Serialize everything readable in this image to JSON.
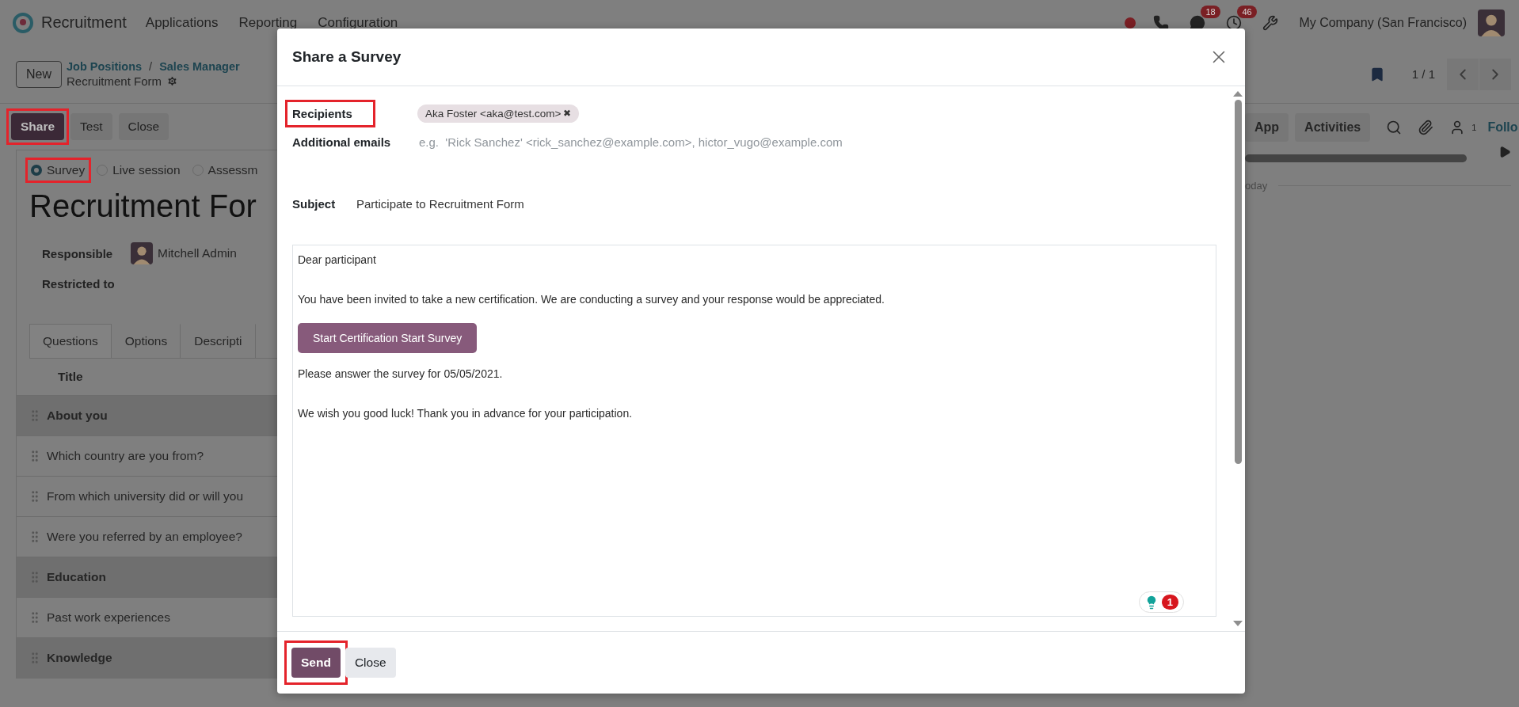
{
  "navbar": {
    "app_name": "Recruitment",
    "menu": [
      "Applications",
      "Reporting",
      "Configuration"
    ],
    "badges": [
      {
        "kind": "chat",
        "count": "18"
      },
      {
        "kind": "activity",
        "count": "46"
      }
    ],
    "company": "My Company (San Francisco)"
  },
  "control_panel": {
    "new_button": "New",
    "breadcrumbs": [
      "Job Positions",
      "Sales Manager"
    ],
    "separator": "/",
    "record": "Recruitment Form",
    "pager": "1 / 1"
  },
  "actions": [
    {
      "label": "Share",
      "primary": true,
      "highlighted": true
    },
    {
      "label": "Test",
      "primary": false,
      "highlighted": false
    },
    {
      "label": "Close",
      "primary": false,
      "highlighted": false
    }
  ],
  "chatter": {
    "buttons": [
      "App",
      "Activities"
    ],
    "followers": "1",
    "follow": "Follo",
    "day_label": "oday"
  },
  "form": {
    "types": [
      {
        "label": "Survey",
        "selected": true,
        "highlighted": true
      },
      {
        "label": "Live session",
        "selected": false,
        "highlighted": false
      },
      {
        "label": "Assessm",
        "selected": false,
        "highlighted": false
      }
    ],
    "title": "Recruitment For",
    "fields": [
      {
        "label": "Responsible",
        "value": "Mitchell Admin",
        "avatar": true
      },
      {
        "label": "Restricted to"
      }
    ],
    "tabs": [
      {
        "label": "Questions",
        "selected": true
      },
      {
        "label": "Options",
        "selected": false
      },
      {
        "label": "Descripti",
        "selected": false
      }
    ],
    "table": {
      "columns": [
        "Title"
      ],
      "rows": [
        {
          "title": "About you",
          "kind": "section"
        },
        {
          "title": "Which country are you from?",
          "kind": "question"
        },
        {
          "title": "From which university did or will you",
          "kind": "question"
        },
        {
          "title": "Were you referred by an employee?",
          "kind": "question"
        },
        {
          "title": "Education",
          "kind": "section"
        },
        {
          "title": "Past work experiences",
          "kind": "question"
        },
        {
          "title": "Knowledge",
          "kind": "section"
        }
      ]
    }
  },
  "dialog": {
    "title": "Share a Survey",
    "recipients": {
      "label": "Recipients",
      "highlighted": true,
      "tags": [
        {
          "label": "Aka Foster <aka@test.com>",
          "remove": "✖"
        }
      ]
    },
    "additional": {
      "label": "Additional emails",
      "placeholder": "e.g.  'Rick Sanchez' <rick_sanchez@example.com>, hictor_vugo@example.com"
    },
    "subject": {
      "label": "Subject",
      "value": "Participate to Recruitment Form"
    },
    "body": [
      {
        "kind": "text",
        "text": "Dear participant"
      },
      {
        "kind": "text",
        "text": "You have been invited to take a new certification. We are conducting a survey and your response would be appreciated."
      },
      {
        "kind": "button",
        "text": "Start Certification Start Survey"
      },
      {
        "kind": "text",
        "text": "Please answer the survey for 05/05/2021."
      },
      {
        "kind": "text",
        "text": "We wish you good luck! Thank you in advance for your participation."
      }
    ],
    "assistant_count": "1",
    "buttons": [
      {
        "label": "Send",
        "primary": true,
        "highlighted": true
      },
      {
        "label": "Close",
        "primary": false,
        "highlighted": false
      }
    ]
  }
}
